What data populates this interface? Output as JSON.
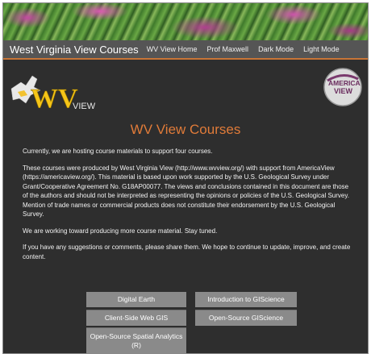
{
  "header": {
    "site_title": "West Virginia View Courses",
    "nav": [
      "WV View Home",
      "Prof Maxwell",
      "Dark Mode",
      "Light Mode"
    ]
  },
  "logos": {
    "wv_letters": "WV",
    "wv_sub": "VIEW",
    "av_top": "AMERICA",
    "av_bottom": "VIEW"
  },
  "main": {
    "title": "WV View Courses",
    "paragraphs": [
      "Currently, we are hosting course materials to support four courses.",
      "These courses were produced by West Virginia View (http://www.wvview.org/) with support from AmericaView (https://americaview.org/). This material is based upon work supported by the U.S. Geological Survey under Grant/Cooperative Agreement No. G18AP00077. The views and conclusions contained in this document are those of the authors and should not be interpreted as representing the opinions or policies of the U.S. Geological Survey. Mention of trade names or commercial products does not constitute their endorsement by the U.S. Geological Survey.",
      "We are working toward producing more course material. Stay tuned.",
      "If you have any suggestions or comments, please share them. We hope to continue to update, improve, and create content."
    ]
  },
  "courses": [
    "Digital Earth",
    "Introduction to GIScience",
    "Client-Side Web GIS",
    "Open-Source GIScience",
    "Open-Source Spatial Analytics (R)"
  ],
  "colors": {
    "accent": "#e07b39",
    "background": "#2e2e2e",
    "navbar": "#555555",
    "button": "#8a8a8a"
  }
}
